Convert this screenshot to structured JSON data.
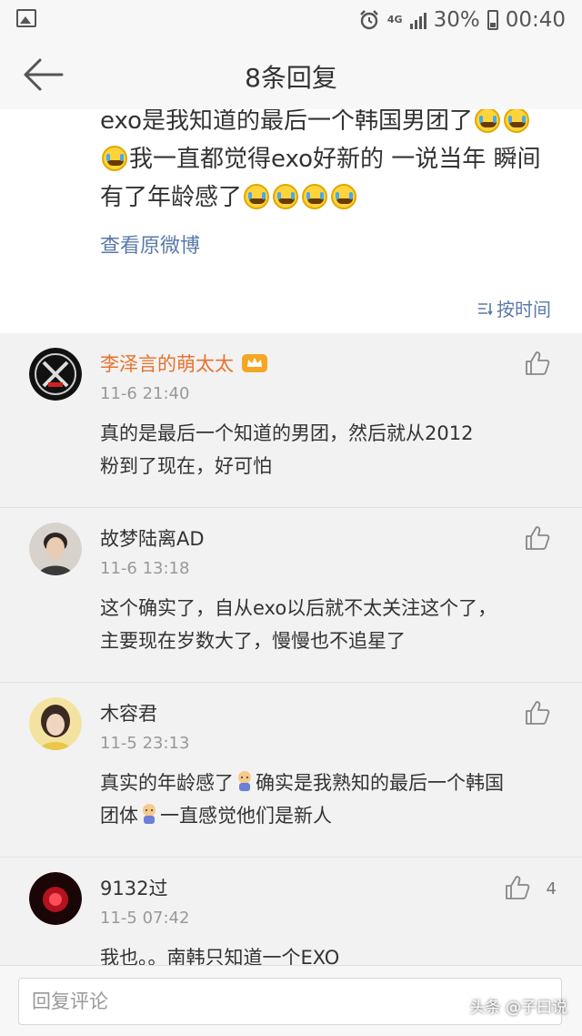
{
  "status_bar": {
    "network": "4G",
    "battery": "30%",
    "time": "00:40",
    "left_icon": "image-icon",
    "alarm_icon": "alarm-icon"
  },
  "header": {
    "title": "8条回复",
    "back_icon": "back-arrow-icon"
  },
  "post": {
    "line1": "exo是我知道的最后一个韩国男团了",
    "line2": "我一直都觉得exo好新的 一说当年 瞬间",
    "line3": "有了年龄感了",
    "view_original": "查看原微博",
    "sort_label": "按时间"
  },
  "comments": [
    {
      "username": "李泽言的萌太太",
      "time": "11-6 21:40",
      "line1": "真的是最后一个知道的男团，然后就从2012",
      "line2": "粉到了现在，好可怕"
    },
    {
      "username": "故梦陆离AD",
      "time": "11-6 13:18",
      "line1": "这个确实了，自从exo以后就不太关注这个了，",
      "line2": "主要现在岁数大了，慢慢也不追星了"
    },
    {
      "username": "木容君",
      "time": "11-5 23:13",
      "line1a": "真实的年龄感了",
      "line1b": "确实是我熟知的最后一个韩国",
      "line2a": "团体",
      "line2b": "一直感觉他们是新人"
    },
    {
      "username": "9132过",
      "time": "11-5 07:42",
      "like_count": "4",
      "line1": "我也。。南韩只知道一个EXO"
    }
  ],
  "reply_bar": {
    "placeholder": "回复评论"
  },
  "watermark": "头条 @子曰说",
  "colors": {
    "link": "#5b7aa8",
    "vip_name": "#e8722c",
    "time": "#999999"
  }
}
